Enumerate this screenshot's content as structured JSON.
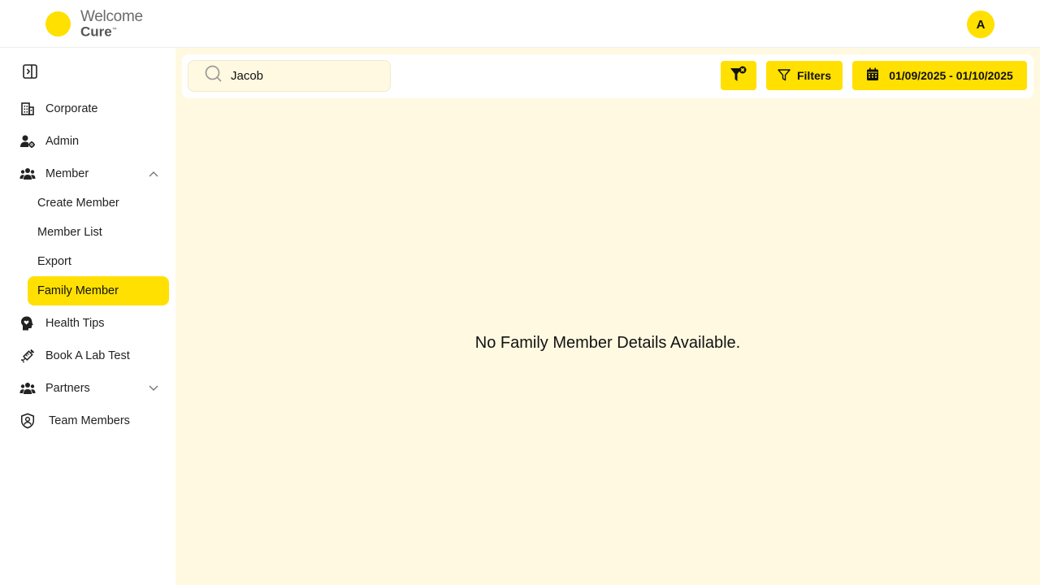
{
  "brand": {
    "line1": "Welcome",
    "line2": "Cure",
    "mark": "™"
  },
  "user": {
    "initial": "A"
  },
  "sidebar": {
    "items": [
      {
        "label": "Corporate",
        "icon": "building-icon"
      },
      {
        "label": "Admin",
        "icon": "user-gear-icon"
      },
      {
        "label": "Member",
        "icon": "users-icon",
        "expanded": true,
        "children": [
          {
            "label": "Create Member"
          },
          {
            "label": "Member List"
          },
          {
            "label": "Export"
          },
          {
            "label": "Family Member",
            "active": true
          }
        ]
      },
      {
        "label": "Health Tips",
        "icon": "head-heart-icon"
      },
      {
        "label": "Book A Lab Test",
        "icon": "syringe-icon"
      },
      {
        "label": "Partners",
        "icon": "users-icon",
        "expanded": false
      },
      {
        "label": "Team Members",
        "icon": "shield-user-icon"
      }
    ]
  },
  "toolbar": {
    "search_value": "Jacob",
    "filters_label": "Filters",
    "date_range": "01/09/2025 - 01/10/2025"
  },
  "main": {
    "empty_message": "No Family Member Details Available."
  },
  "colors": {
    "accent": "#FFE000",
    "background": "#FFF9E1"
  }
}
